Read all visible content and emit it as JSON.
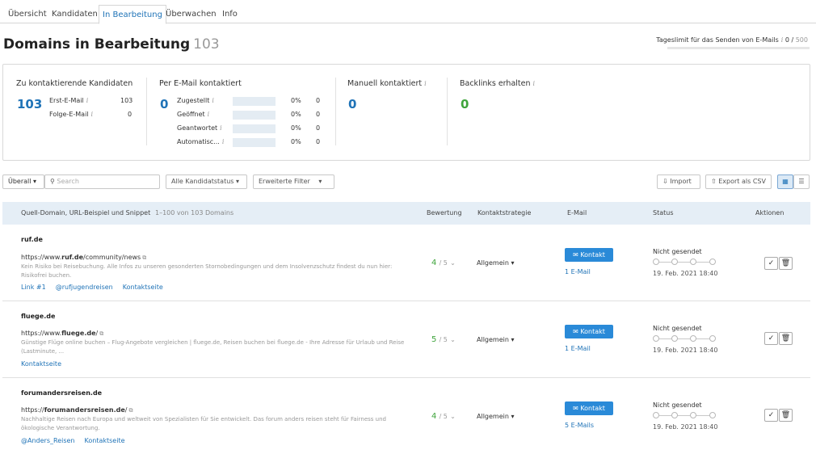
{
  "tabs": [
    "Übersicht",
    "Kandidaten",
    "In Bearbeitung",
    "Überwachen",
    "Info"
  ],
  "header": {
    "title": "Domains in Bearbeitung",
    "count": "103",
    "limit_label": "Tageslimit für das Senden von E-Mails",
    "limit_used": "0",
    "limit_total": "500"
  },
  "summary": {
    "candidates": {
      "title": "Zu kontaktierende Kandidaten",
      "total": "103",
      "first_label": "Erst-E-Mail",
      "first_value": "103",
      "follow_label": "Folge-E-Mail",
      "follow_value": "0"
    },
    "email": {
      "title": "Per E-Mail kontaktiert",
      "total": "0",
      "rows": [
        {
          "label": "Zugestellt",
          "pct": "0%",
          "value": "0"
        },
        {
          "label": "Geöffnet",
          "pct": "0%",
          "value": "0"
        },
        {
          "label": "Geantwortet",
          "pct": "0%",
          "value": "0"
        },
        {
          "label": "Automatisc...",
          "pct": "0%",
          "value": "0"
        }
      ]
    },
    "manual": {
      "title": "Manuell kontaktiert",
      "total": "0"
    },
    "backlinks": {
      "title": "Backlinks erhalten",
      "total": "0"
    }
  },
  "filters": {
    "scope": "Überall",
    "search_placeholder": "Search",
    "status": "Alle Kandidatstatus",
    "advanced": "Erweiterte Filter",
    "import": "Import",
    "export": "Export als CSV"
  },
  "table": {
    "headers": {
      "source": "Quell-Domain, URL-Beispiel und Snippet",
      "range": "1–100 von 103 Domains",
      "rating": "Bewertung",
      "strategy": "Kontaktstrategie",
      "email": "E-Mail",
      "status": "Status",
      "actions": "Aktionen"
    },
    "rows": [
      {
        "domain": "ruf.de",
        "url_pre": "https://www.",
        "url_bold": "ruf.de",
        "url_post": "/community/news",
        "snippet": "Kein Risiko bei Reisebuchung. Alle Infos zu unseren gesonderten Stornobedingungen und dem Insolvenzschutz findest du nun hier: Risikofrei buchen.",
        "links": [
          "Link #1",
          "@rufjugendreisen",
          "Kontaktseite"
        ],
        "score": "4",
        "score_max": "/ 5",
        "strategy": "Allgemein",
        "contact": "Kontakt",
        "emails": "1 E-Mail",
        "status": "Nicht gesendet",
        "date": "19. Feb. 2021 18:40"
      },
      {
        "domain": "fluege.de",
        "url_pre": "https://www.",
        "url_bold": "fluege.de",
        "url_post": "/",
        "snippet": "Günstige Flüge online buchen – Flug-Angebote vergleichen | fluege.de, Reisen buchen bei fluege.de - Ihre Adresse für Urlaub und Reise (Lastminute, ...",
        "links": [
          "Kontaktseite"
        ],
        "score": "5",
        "score_max": "/ 5",
        "strategy": "Allgemein",
        "contact": "Kontakt",
        "emails": "1 E-Mail",
        "status": "Nicht gesendet",
        "date": "19. Feb. 2021 18:40"
      },
      {
        "domain": "forumandersreisen.de",
        "url_pre": "https://",
        "url_bold": "forumandersreisen.de",
        "url_post": "/",
        "snippet": "Nachhaltige Reisen nach Europa und weltweit von Spezialisten für Sie entwickelt. Das forum anders reisen steht für Fairness und ökologische Verantwortung.",
        "links": [
          "@Anders_Reisen",
          "Kontaktseite"
        ],
        "score": "4",
        "score_max": "/ 5",
        "strategy": "Allgemein",
        "contact": "Kontakt",
        "emails": "5 E-Mails",
        "status": "Nicht gesendet",
        "date": "19. Feb. 2021 18:40"
      }
    ]
  }
}
